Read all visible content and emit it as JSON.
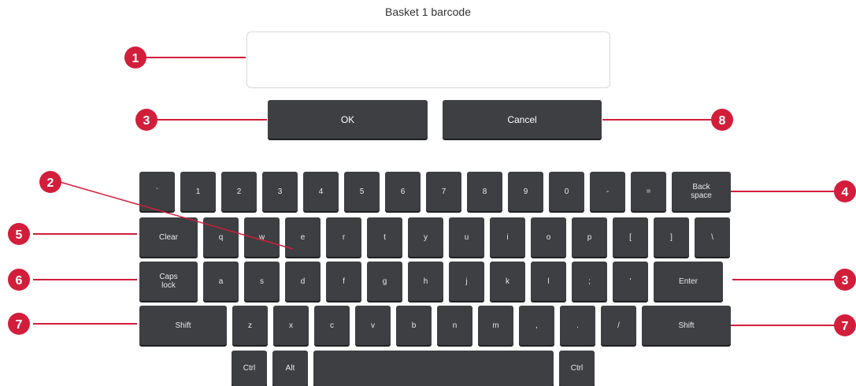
{
  "title": "Basket 1 barcode",
  "barcode_input": {
    "value": "",
    "placeholder": ""
  },
  "buttons": {
    "ok": "OK",
    "cancel": "Cancel"
  },
  "keyboard": {
    "row1": [
      "`",
      "1",
      "2",
      "3",
      "4",
      "5",
      "6",
      "7",
      "8",
      "9",
      "0",
      "-",
      "=",
      "Back space"
    ],
    "row2": [
      "Clear",
      "q",
      "w",
      "e",
      "r",
      "t",
      "y",
      "u",
      "i",
      "o",
      "p",
      "[",
      "]",
      "\\"
    ],
    "row3": [
      "Caps lock",
      "a",
      "s",
      "d",
      "f",
      "g",
      "h",
      "j",
      "k",
      "l",
      ";",
      "'",
      "Enter"
    ],
    "row4": [
      "Shift",
      "z",
      "x",
      "c",
      "v",
      "b",
      "n",
      "m",
      ",",
      ".",
      "/",
      "Shift"
    ],
    "row5": [
      "Ctrl",
      "Alt",
      "",
      "Ctrl"
    ]
  },
  "callouts": [
    "1",
    "2",
    "3",
    "3",
    "4",
    "5",
    "6",
    "7",
    "7",
    "8"
  ],
  "colors": {
    "key": "#3d3f42",
    "callout": "#d21e3b",
    "key_text": "#e8e8e8"
  }
}
